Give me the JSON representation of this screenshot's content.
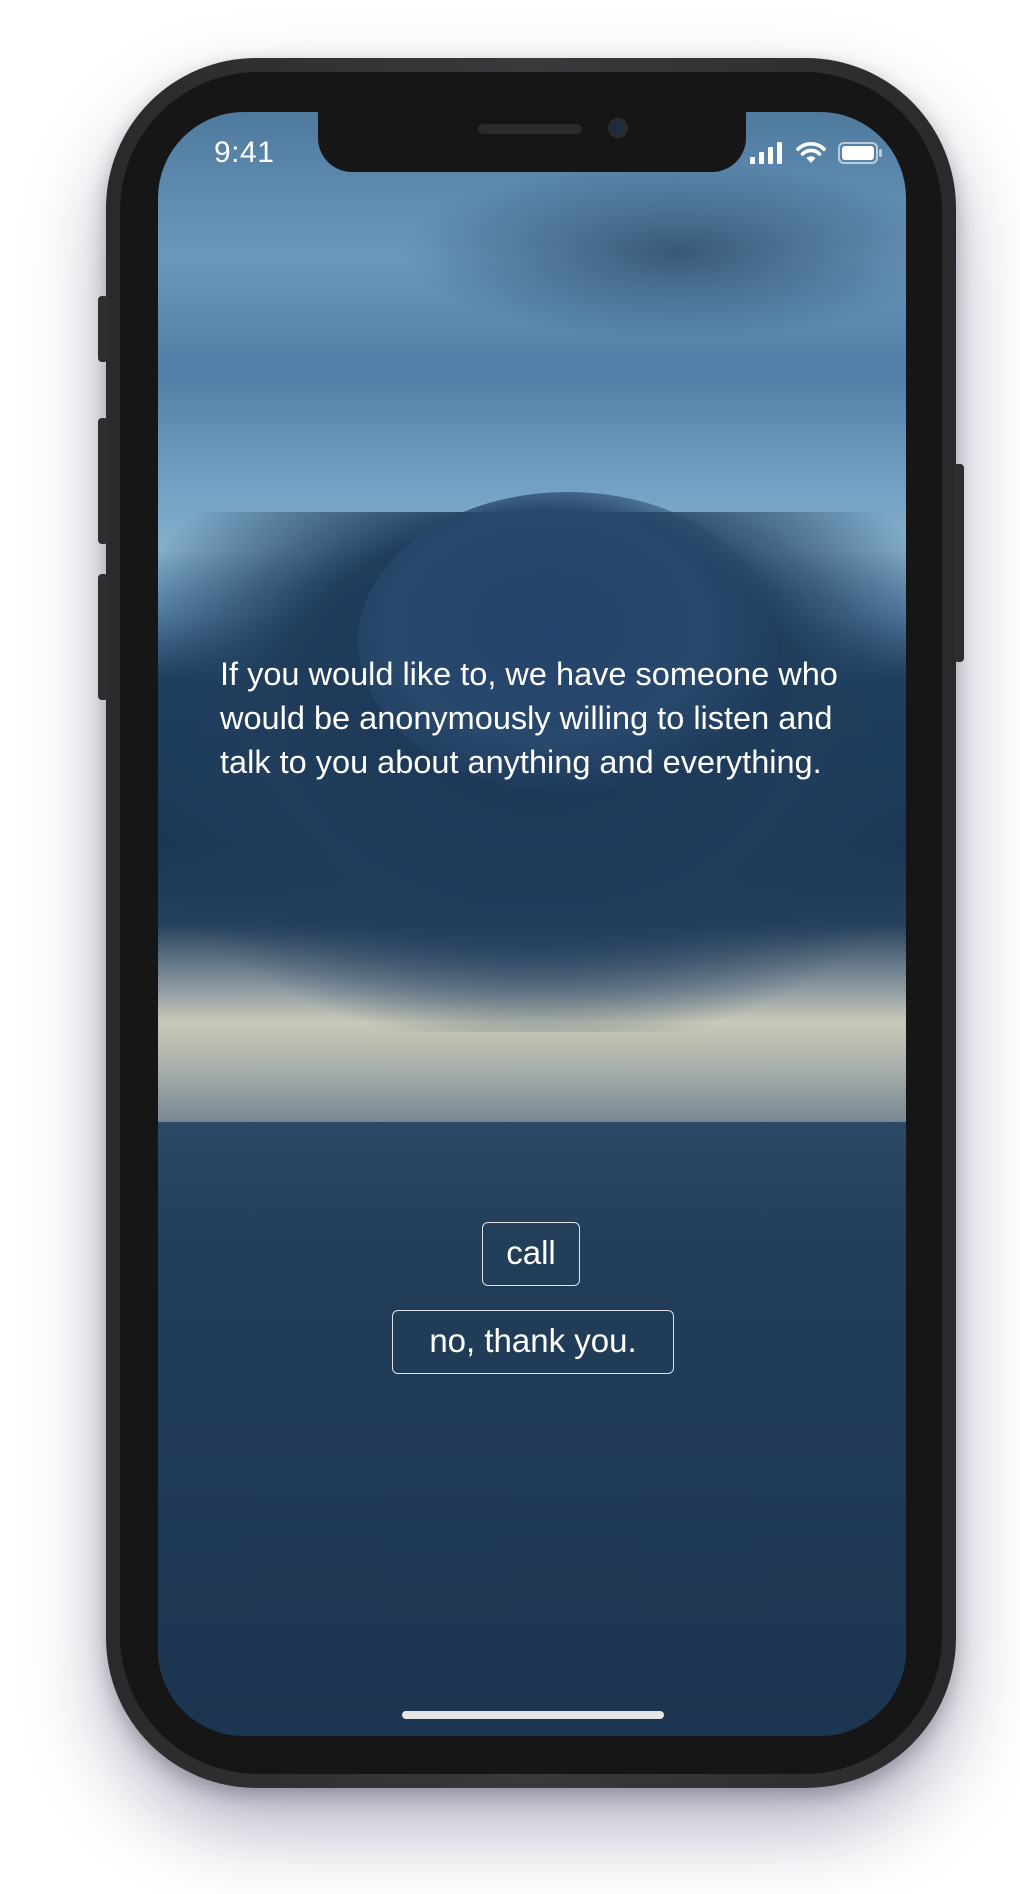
{
  "status_bar": {
    "time": "9:41",
    "icons": [
      "signal-icon",
      "wifi-icon",
      "battery-icon"
    ]
  },
  "message": {
    "text": "If you would like to, we have someone who would be anonymously willing to listen and talk to you about anything and everything."
  },
  "actions": {
    "call_label": "call",
    "decline_label": "no, thank you."
  },
  "colors": {
    "text": "#ffffff",
    "button_border": "#ffffff",
    "phone_frame": "#2a2a2c",
    "sky_top": "#4e7a9e",
    "cloud": "#1f3f60",
    "sea": "#1c3550"
  }
}
